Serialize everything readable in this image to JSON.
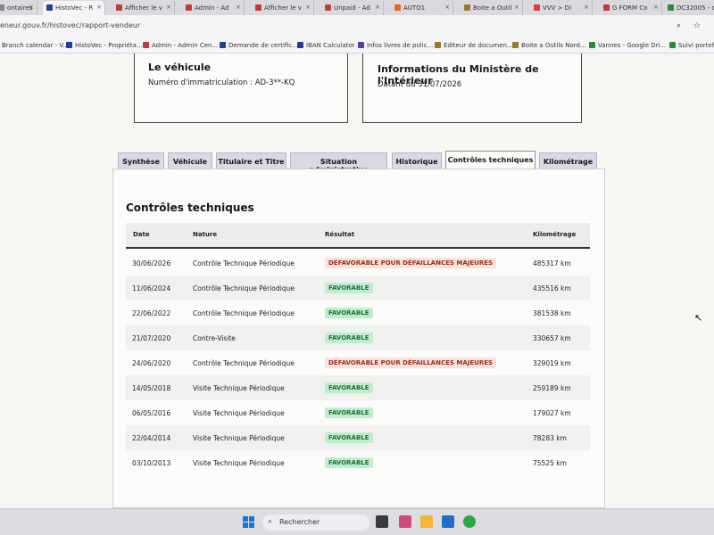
{
  "browser": {
    "tabs": [
      {
        "label": "ontaires",
        "color": "#888888",
        "active": false
      },
      {
        "label": "HistoVec - R",
        "color": "#1f3f9a",
        "active": true
      },
      {
        "label": "Afficher le v",
        "color": "#c23a3a",
        "active": false
      },
      {
        "label": "Admin - Ad",
        "color": "#c23a3a",
        "active": false
      },
      {
        "label": "Afficher le v",
        "color": "#c23a3a",
        "active": false
      },
      {
        "label": "Unpaid - Ad",
        "color": "#c23a3a",
        "active": false
      },
      {
        "label": "AUTO1",
        "color": "#e06a1a",
        "active": false
      },
      {
        "label": "Boite a Outil",
        "color": "#9a7a2a",
        "active": false
      },
      {
        "label": "VVV > Di",
        "color": "#e03a3a",
        "active": false
      },
      {
        "label": "G FORM Co",
        "color": "#c23a3a",
        "active": false
      },
      {
        "label": "DC32005 - d",
        "color": "#2a8a3a",
        "active": false
      }
    ],
    "url": "eneur.gouv.fr/histovec/rapport-vendeur",
    "addr_icons": [
      "search-icon",
      "star-icon"
    ],
    "bookmarks": [
      {
        "label": "Branch calendar - V...",
        "color": "#2a6ad0"
      },
      {
        "label": "HistoVec - Propriéta...",
        "color": "#1f3f9a"
      },
      {
        "label": "Admin - Admin Cen...",
        "color": "#c23a3a"
      },
      {
        "label": "Demande de certific...",
        "color": "#1f3f9a"
      },
      {
        "label": "IBAN Calculator",
        "color": "#2a3a8a"
      },
      {
        "label": "Infos livres de polic...",
        "color": "#5a3a9a"
      },
      {
        "label": "Editeur de documen...",
        "color": "#9a7a2a"
      },
      {
        "label": "Boite a Outils Nord...",
        "color": "#9a7a2a"
      },
      {
        "label": "Vannes - Google Dri...",
        "color": "#2a8a3a"
      },
      {
        "label": "Suivi portefeuil",
        "color": "#2a8a3a"
      }
    ]
  },
  "cards": {
    "vehicle": {
      "title": "Le véhicule",
      "subtitle": "Numéro d'immatriculation : AD-3**-KQ"
    },
    "ministry": {
      "title": "Informations du Ministère de l'Intérieur",
      "subtitle": "Datant du 31/07/2026"
    }
  },
  "page_tabs": [
    {
      "label": "Synthèse",
      "active": false
    },
    {
      "label": "Véhicule",
      "active": false
    },
    {
      "label": "Titulaire et Titre",
      "active": false
    },
    {
      "label": "Situation administrative",
      "active": false
    },
    {
      "label": "Historique",
      "active": false
    },
    {
      "label": "Contrôles techniques",
      "active": true
    },
    {
      "label": "Kilométrage",
      "active": false
    }
  ],
  "section": {
    "title": "Contrôles techniques",
    "headers": {
      "date": "Date",
      "nature": "Nature",
      "result": "Résultat",
      "mileage": "Kilométrage"
    },
    "rows": [
      {
        "date": "30/06/2026",
        "nature": "Contrôle Technique Périodique",
        "result": "DÉFAVORABLE POUR DÉFAILLANCES MAJEURES",
        "status": "bad",
        "mileage": "485317 km"
      },
      {
        "date": "11/06/2024",
        "nature": "Contrôle Technique Périodique",
        "result": "FAVORABLE",
        "status": "good",
        "mileage": "435516 km"
      },
      {
        "date": "22/06/2022",
        "nature": "Contrôle Technique Périodique",
        "result": "FAVORABLE",
        "status": "good",
        "mileage": "381538 km"
      },
      {
        "date": "21/07/2020",
        "nature": "Contre-Visite",
        "result": "FAVORABLE",
        "status": "good",
        "mileage": "330657 km"
      },
      {
        "date": "24/06/2020",
        "nature": "Contrôle Technique Périodique",
        "result": "DÉFAVORABLE POUR DÉFAILLANCES MAJEURES",
        "status": "bad",
        "mileage": "329019 km"
      },
      {
        "date": "14/05/2018",
        "nature": "Visite Technique Périodique",
        "result": "FAVORABLE",
        "status": "good",
        "mileage": "259189 km"
      },
      {
        "date": "06/05/2016",
        "nature": "Visite Technique Périodique",
        "result": "FAVORABLE",
        "status": "good",
        "mileage": "179027 km"
      },
      {
        "date": "22/04/2014",
        "nature": "Visite Technique Périodique",
        "result": "FAVORABLE",
        "status": "good",
        "mileage": "78283 km"
      },
      {
        "date": "03/10/2013",
        "nature": "Visite Technique Périodique",
        "result": "FAVORABLE",
        "status": "good",
        "mileage": "75525 km"
      }
    ]
  },
  "taskbar": {
    "search_placeholder": "Rechercher",
    "apps": [
      {
        "name": "task-view-icon",
        "color": "#3a3a3a"
      },
      {
        "name": "snipping-tool-icon",
        "color": "#d04a7a"
      },
      {
        "name": "file-explorer-icon",
        "color": "#f2b632"
      },
      {
        "name": "outlook-icon",
        "color": "#1f6fc8"
      },
      {
        "name": "chrome-icon",
        "color": "#2aa84a"
      }
    ]
  }
}
